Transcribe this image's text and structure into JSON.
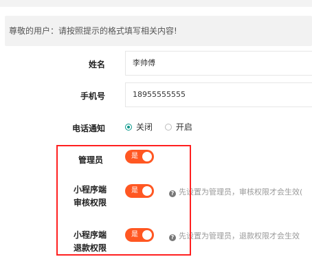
{
  "notice": "尊敬的用户：请按照提示的格式填写相关内容!",
  "fields": {
    "name": {
      "label": "姓名",
      "value": "李帅傅"
    },
    "phone": {
      "label": "手机号",
      "value": "18955555555"
    },
    "call_notify": {
      "label": "电话通知",
      "options": [
        "关闭",
        "开启"
      ],
      "selected": "关闭"
    },
    "admin": {
      "label": "管理员",
      "switch_text": "是",
      "on": true
    },
    "mini_review": {
      "label_line1": "小程序端",
      "label_line2": "审核权限",
      "switch_text": "是",
      "on": true,
      "hint": "先设置为管理员，审核权限才会生效("
    },
    "mini_refund": {
      "label_line1": "小程序端",
      "label_line2": "退款权限",
      "switch_text": "是",
      "on": true,
      "hint": "先设置为管理员，退款权限才会生效"
    }
  },
  "colors": {
    "switch_on": "#ff5722",
    "radio_checked": "#009688",
    "highlight_box": "#ff1f1f"
  },
  "icons": {
    "hint": "question-circle-icon"
  }
}
